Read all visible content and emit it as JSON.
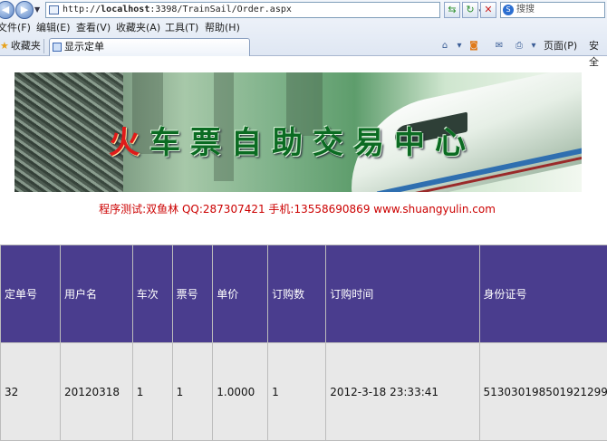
{
  "browser": {
    "address": "http://localhost:3398/TrainSail/Order.aspx",
    "address_prefix": "http://",
    "address_host": "localhost",
    "address_rest": ":3398/TrainSail/Order.aspx",
    "search_placeholder": "搜搜",
    "menu": [
      "文件(F)",
      "编辑(E)",
      "查看(V)",
      "收藏夹(A)",
      "工具(T)",
      "帮助(H)"
    ],
    "favorites_label": "收藏夹",
    "tab_title": "显示定单",
    "commands": {
      "page": "页面(P)",
      "safety": "安全"
    }
  },
  "banner": {
    "title_first": "火",
    "title_rest": "车票自助交易中心"
  },
  "credit": "程序测试:双鱼林 QQ:287307421 手机:13558690869 www.shuangyulin.com",
  "table": {
    "headers": [
      "定单号",
      "用户名",
      "车次",
      "票号",
      "单价",
      "订购数",
      "订购时间",
      "身份证号"
    ],
    "rows": [
      [
        "32",
        "20120318",
        "1",
        "1",
        "1.0000",
        "1",
        "2012-3-18 23:33:41",
        "513030198501921299"
      ]
    ]
  }
}
